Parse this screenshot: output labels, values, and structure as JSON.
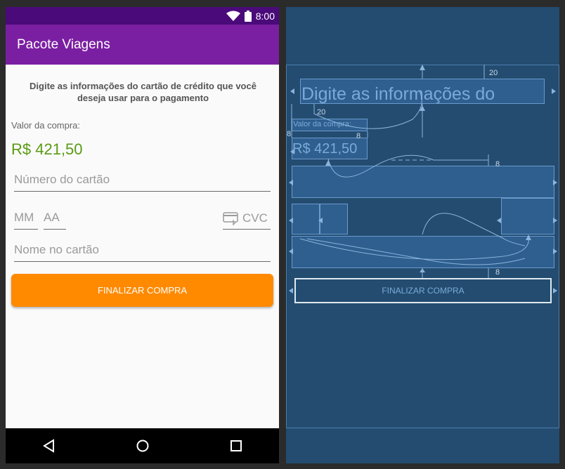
{
  "status_bar": {
    "time": "8:00"
  },
  "app_bar": {
    "title": "Pacote Viagens"
  },
  "form": {
    "instructions": "Digite as informações do cartão de crédito que você deseja usar para o pagamento",
    "amount_label": "Valor da compra:",
    "amount_value": "R$ 421,50",
    "card_number_placeholder": "Número do cartão",
    "month_placeholder": "MM",
    "year_placeholder": "AA",
    "cvc_placeholder": "CVC",
    "name_placeholder": "Nome no cartão",
    "submit_label": "FINALIZAR COMPRA"
  },
  "nav_icons": [
    "back-icon",
    "home-icon",
    "recents-icon"
  ],
  "blueprint": {
    "instructions_preview": "Digite as informações do",
    "amount_label": "Valor da compra:",
    "amount_value": "R$ 421,50",
    "submit_label": "FINALIZAR COMPRA",
    "margins": [
      "20",
      "20",
      "8",
      "8",
      "8",
      "8"
    ]
  },
  "colors": {
    "status_bar": "#4a0a7a",
    "app_bar": "#7b1fa2",
    "price": "#5a9a14",
    "button": "#ff8a00",
    "blueprint_bg": "#234c70"
  }
}
